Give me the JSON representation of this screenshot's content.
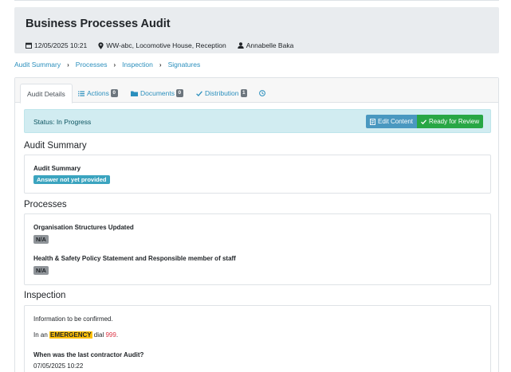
{
  "header": {
    "title": "Business Processes Audit",
    "datetime": "12/05/2025 10:21",
    "location": "WW-abc, Locomotive House, Reception",
    "user": "Annabelle Baka"
  },
  "breadcrumb": [
    "Audit Summary",
    "Processes",
    "Inspection",
    "Signatures"
  ],
  "tabs": {
    "audit_details": "Audit Details",
    "actions": "Actions",
    "actions_count": "0",
    "documents": "Documents",
    "documents_count": "0",
    "distribution": "Distribution",
    "distribution_count": "1"
  },
  "status": {
    "text": "Status: In Progress",
    "edit_label": "Edit Content",
    "ready_label": "Ready for Review"
  },
  "sections": {
    "audit_summary": {
      "title": "Audit Summary",
      "question": "Audit Summary",
      "answer": "Answer not yet provided"
    },
    "processes": {
      "title": "Processes",
      "q1": "Organisation Structures Updated",
      "a1": "N/A",
      "q2": "Health & Safety Policy Statement and Responsible member of staff",
      "a2": "N/A"
    },
    "inspection": {
      "title": "Inspection",
      "info": "Information to be confirmed.",
      "emergency_prefix": "In an ",
      "emergency_word": "EMERGENCY",
      "emergency_mid": " dial ",
      "emergency_number": "999",
      "emergency_suffix": ".",
      "q1": "When was the last contractor Audit?",
      "a1": "07/05/2025 10:22"
    }
  },
  "colors": {
    "link": "#2b8fbd",
    "status_bg": "#d1ecf1",
    "edit_button": "#4a98c0",
    "ready_button": "#28a745",
    "highlight": "#ffc107"
  }
}
